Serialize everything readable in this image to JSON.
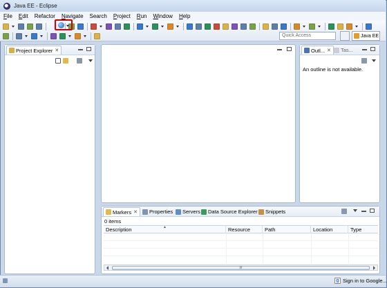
{
  "window": {
    "title": "Java EE - Eclipse"
  },
  "menu": [
    {
      "label": "File",
      "u": "F",
      "rest": "ile"
    },
    {
      "label": "Edit",
      "u": "E",
      "rest": "dit"
    },
    {
      "label": "Refactor",
      "u": "",
      "rest": "Refactor"
    },
    {
      "label": "Navigate",
      "u": "N",
      "rest": "avigate"
    },
    {
      "label": "Search",
      "u": "",
      "rest": "Search"
    },
    {
      "label": "Project",
      "u": "P",
      "rest": "roject"
    },
    {
      "label": "Run",
      "u": "R",
      "rest": "un"
    },
    {
      "label": "Window",
      "u": "W",
      "rest": "indow"
    },
    {
      "label": "Help",
      "u": "H",
      "rest": "elp"
    }
  ],
  "toolbar": {
    "quick_access_placeholder": "Quick Access",
    "perspective_label": "Java EE",
    "icon_colors": [
      "#d9b24a",
      "#5f7fa8",
      "#7aa04a",
      "#3a78c8",
      "#c94b3b",
      "#7c52b5",
      "#2f8f5a",
      "#d68b2a"
    ]
  },
  "project_explorer": {
    "tab_label": "Project Explorer"
  },
  "outline": {
    "tab_label": "Outl...",
    "tab2_label": "Tas...",
    "message": "An outline is not available."
  },
  "bottom_panel": {
    "tabs": [
      "Markers",
      "Properties",
      "Servers",
      "Data Source Explorer",
      "Snippets"
    ],
    "items_count": "0 items",
    "columns": [
      "Description",
      "Resource",
      "Path",
      "Location",
      "Type"
    ],
    "scroll_grip": "III"
  },
  "status": {
    "signin_label": "Sign in to Google..."
  }
}
